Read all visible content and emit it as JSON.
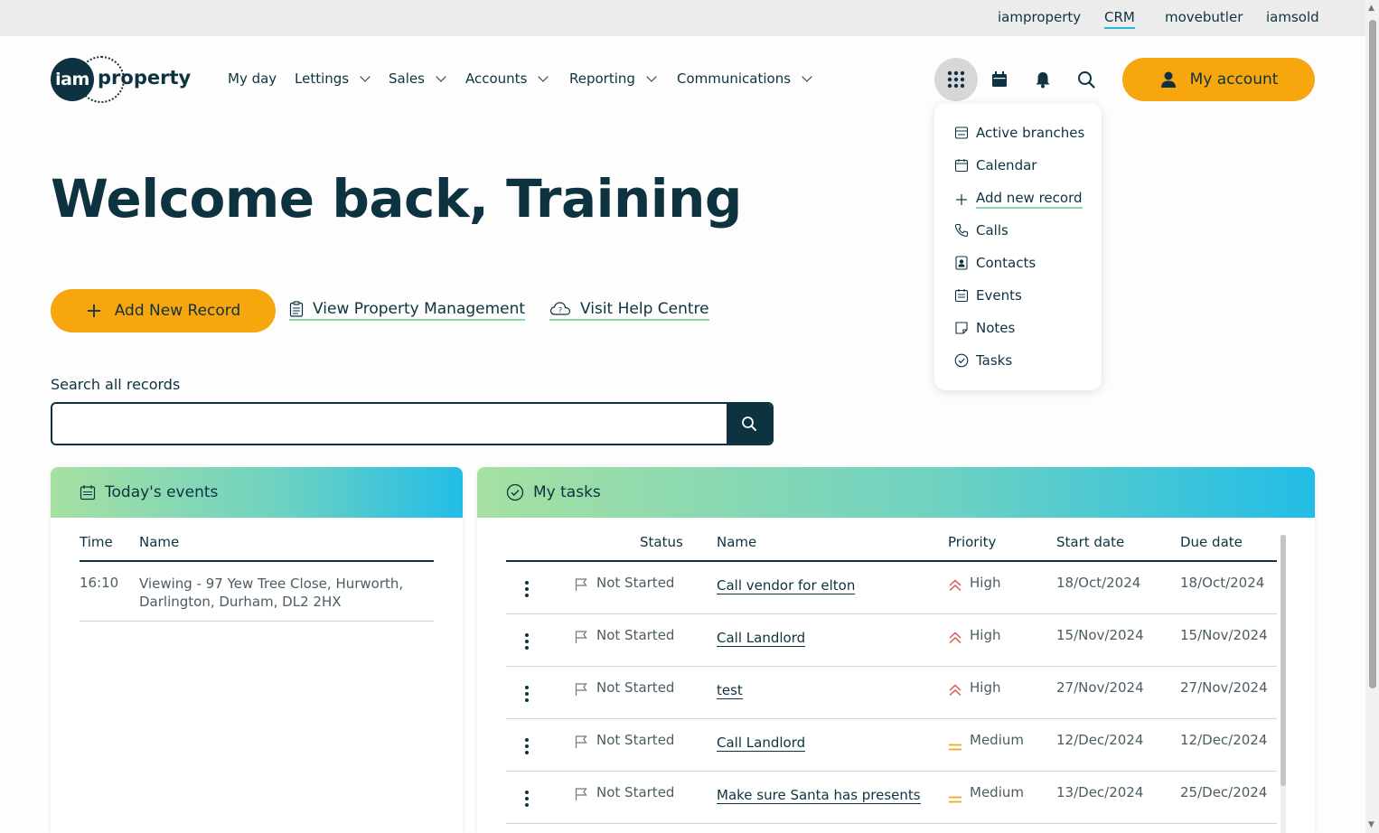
{
  "top_links": [
    {
      "label": "iamproperty",
      "active": false
    },
    {
      "label": "CRM",
      "active": true
    },
    {
      "label": "movebutler",
      "active": false
    },
    {
      "label": "iamsold",
      "active": false
    }
  ],
  "logo": {
    "mark": "iam",
    "word": "property"
  },
  "nav": {
    "my_day": "My day",
    "lettings": "Lettings",
    "sales": "Sales",
    "accounts": "Accounts",
    "reporting": "Reporting",
    "communications": "Communications"
  },
  "header": {
    "account_label": "My account"
  },
  "dropdown": {
    "items": [
      {
        "label": "Active branches",
        "icon": "branches-icon"
      },
      {
        "label": "Calendar",
        "icon": "calendar-icon"
      },
      {
        "label": "Add new record",
        "icon": "plus-icon"
      },
      {
        "label": "Calls",
        "icon": "phone-icon"
      },
      {
        "label": "Contacts",
        "icon": "contact-card-icon"
      },
      {
        "label": "Events",
        "icon": "events-icon"
      },
      {
        "label": "Notes",
        "icon": "note-icon"
      },
      {
        "label": "Tasks",
        "icon": "check-circle-icon"
      }
    ]
  },
  "welcome": "Welcome back, Training",
  "actions": {
    "add_new_record": "Add New Record",
    "view_property_management": "View Property Management",
    "visit_help_centre": "Visit Help Centre"
  },
  "search": {
    "label": "Search all records",
    "value": "",
    "placeholder": ""
  },
  "events": {
    "title": "Today's events",
    "columns": {
      "time": "Time",
      "name": "Name"
    },
    "rows": [
      {
        "time": "16:10",
        "name_line1": "Viewing - 97 Yew Tree Close, Hurworth,",
        "name_line2": "Darlington, Durham, DL2 2HX"
      }
    ]
  },
  "tasks": {
    "title": "My tasks",
    "columns": {
      "status": "Status",
      "name": "Name",
      "priority": "Priority",
      "start": "Start date",
      "due": "Due date"
    },
    "rows": [
      {
        "status": "Not Started",
        "name": "Call vendor for elton",
        "priority": "High",
        "start": "18/Oct/2024",
        "due": "18/Oct/2024"
      },
      {
        "status": "Not Started",
        "name": "Call Landlord",
        "priority": "High",
        "start": "15/Nov/2024",
        "due": "15/Nov/2024"
      },
      {
        "status": "Not Started",
        "name": "test",
        "priority": "High",
        "start": "27/Nov/2024",
        "due": "27/Nov/2024"
      },
      {
        "status": "Not Started",
        "name": "Call Landlord",
        "priority": "Medium",
        "start": "12/Dec/2024",
        "due": "12/Dec/2024"
      },
      {
        "status": "Not Started",
        "name": "Make sure Santa has presents",
        "priority": "Medium",
        "start": "13/Dec/2024",
        "due": "25/Dec/2024"
      }
    ]
  },
  "colors": {
    "brand_dark": "#0e3340",
    "accent_orange": "#f7a60e",
    "high_priority": "#d9534f",
    "medium_priority": "#f0a830"
  }
}
